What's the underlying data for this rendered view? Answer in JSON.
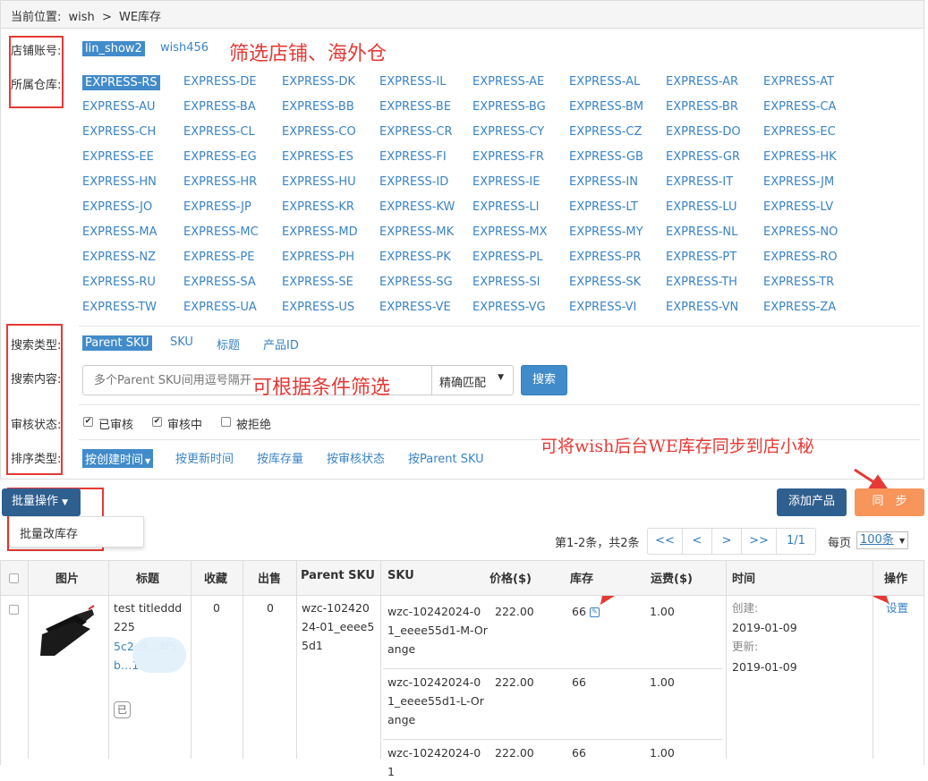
{
  "breadcrumb": {
    "label": "当前位置:",
    "root": "wish",
    "sep": ">",
    "current": "WE库存"
  },
  "filters": {
    "store_label": "店铺账号:",
    "stores": [
      "lin_show2",
      "wish456"
    ],
    "warehouse_label": "所属仓库:",
    "warehouses": [
      [
        "EXPRESS-RS",
        "EXPRESS-DE",
        "EXPRESS-DK",
        "EXPRESS-IL",
        "EXPRESS-AE",
        "EXPRESS-AL",
        "EXPRESS-AR",
        "EXPRESS-AT"
      ],
      [
        "EXPRESS-AU",
        "EXPRESS-BA",
        "EXPRESS-BB",
        "EXPRESS-BE",
        "EXPRESS-BG",
        "EXPRESS-BM",
        "EXPRESS-BR",
        "EXPRESS-CA"
      ],
      [
        "EXPRESS-CH",
        "EXPRESS-CL",
        "EXPRESS-CO",
        "EXPRESS-CR",
        "EXPRESS-CY",
        "EXPRESS-CZ",
        "EXPRESS-DO",
        "EXPRESS-EC"
      ],
      [
        "EXPRESS-EE",
        "EXPRESS-EG",
        "EXPRESS-ES",
        "EXPRESS-FI",
        "EXPRESS-FR",
        "EXPRESS-GB",
        "EXPRESS-GR",
        "EXPRESS-HK"
      ],
      [
        "EXPRESS-HN",
        "EXPRESS-HR",
        "EXPRESS-HU",
        "EXPRESS-ID",
        "EXPRESS-IE",
        "EXPRESS-IN",
        "EXPRESS-IT",
        "EXPRESS-JM"
      ],
      [
        "EXPRESS-JO",
        "EXPRESS-JP",
        "EXPRESS-KR",
        "EXPRESS-KW",
        "EXPRESS-LI",
        "EXPRESS-LT",
        "EXPRESS-LU",
        "EXPRESS-LV"
      ],
      [
        "EXPRESS-MA",
        "EXPRESS-MC",
        "EXPRESS-MD",
        "EXPRESS-MK",
        "EXPRESS-MX",
        "EXPRESS-MY",
        "EXPRESS-NL",
        "EXPRESS-NO"
      ],
      [
        "EXPRESS-NZ",
        "EXPRESS-PE",
        "EXPRESS-PH",
        "EXPRESS-PK",
        "EXPRESS-PL",
        "EXPRESS-PR",
        "EXPRESS-PT",
        "EXPRESS-RO"
      ],
      [
        "EXPRESS-RU",
        "EXPRESS-SA",
        "EXPRESS-SE",
        "EXPRESS-SG",
        "EXPRESS-SI",
        "EXPRESS-SK",
        "EXPRESS-TH",
        "EXPRESS-TR"
      ],
      [
        "EXPRESS-TW",
        "EXPRESS-UA",
        "EXPRESS-US",
        "EXPRESS-VE",
        "EXPRESS-VG",
        "EXPRESS-VI",
        "EXPRESS-VN",
        "EXPRESS-ZA"
      ]
    ],
    "search_type_label": "搜索类型:",
    "search_types": [
      "Parent SKU",
      "SKU",
      "标题",
      "产品ID"
    ],
    "search_content_label": "搜索内容:",
    "search_placeholder": "多个Parent SKU间用逗号隔开",
    "match_mode": "精确匹配",
    "search_button": "搜索",
    "review_label": "审核状态:",
    "review_options": [
      {
        "label": "已审核",
        "checked": "✔"
      },
      {
        "label": "审核中",
        "checked": "✔"
      },
      {
        "label": "被拒绝",
        "checked": ""
      }
    ],
    "sort_label": "排序类型:",
    "sort_options": [
      "按创建时间",
      "按更新时间",
      "按库存量",
      "按审核状态",
      "按Parent SKU"
    ]
  },
  "annotations": {
    "filter_store": "筛选店铺、海外仓",
    "filter_conditions": "可根据条件筛选",
    "sync_hint": "可将wish后台WE库存同步到店小秘"
  },
  "toolbar": {
    "batch_label": "批量操作",
    "batch_menu_item": "批量改库存",
    "add_product": "添加产品",
    "sync": "同　步"
  },
  "pagination": {
    "summary": "第1-2条，共2条",
    "first": "<<",
    "prev": "<",
    "next": ">",
    "last": ">>",
    "page": "1/1",
    "per_page_label": "每页",
    "per_page_value": "100条"
  },
  "table": {
    "headers": [
      "图片",
      "标题",
      "收藏",
      "出售",
      "Parent SKU",
      "SKU",
      "价格($)",
      "库存",
      "运费($)",
      "时间",
      "操作"
    ],
    "row": {
      "title": "test titleddd225",
      "title_id": "5c2c9…4f5b…1",
      "title_tag": "已",
      "favorites": "0",
      "sold": "0",
      "parent_sku": "wzc-10242024-01_eeee55d1",
      "created_label": "创建:",
      "created": "2019-01-09",
      "updated_label": "更新:",
      "updated": "2019-01-09",
      "action": "设置",
      "variants": [
        {
          "sku": "wzc-10242024-01_eeee55d1-M-Orange",
          "price": "222.00",
          "stock": "66",
          "shipping": "1.00"
        },
        {
          "sku": "wzc-10242024-01_eeee55d1-L-Orange",
          "price": "222.00",
          "stock": "66",
          "shipping": "1.00"
        },
        {
          "sku": "wzc-10242024-01",
          "price": "222.00",
          "stock": "66",
          "shipping": "1.00"
        }
      ]
    }
  },
  "colors": {
    "link": "#3a83c4",
    "primary": "#428bca",
    "dark_button": "#2f5f8f",
    "sync": "#f7955b",
    "annotation": "#e53935"
  }
}
